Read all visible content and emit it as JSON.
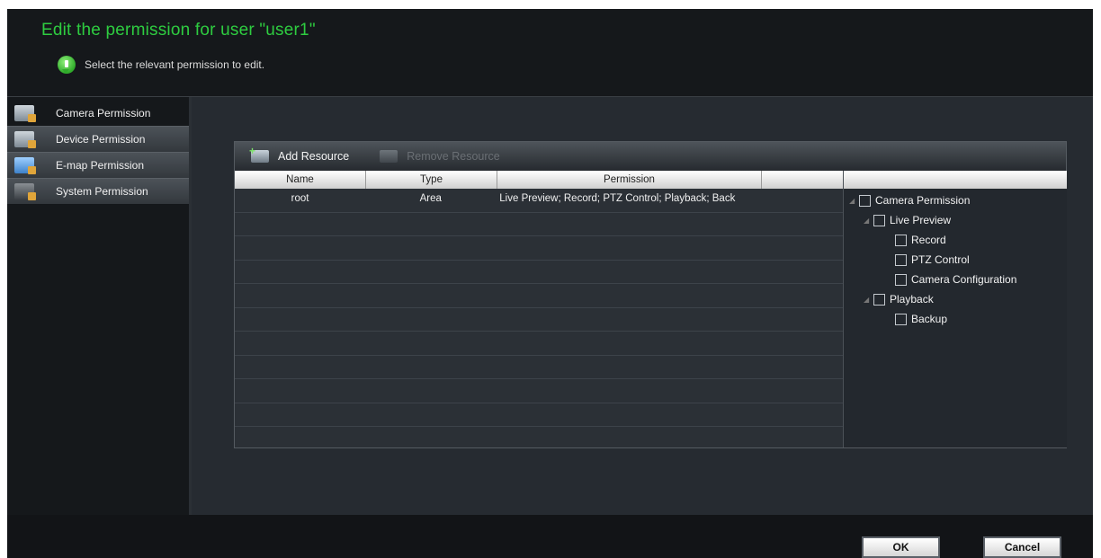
{
  "header": {
    "title": "Edit the permission for user \"user1\"",
    "hint": "Select the relevant permission to edit."
  },
  "sidebar": {
    "items": [
      {
        "label": "Camera Permission",
        "icon": "camera-lock-icon"
      },
      {
        "label": "Device Permission",
        "icon": "device-lock-icon"
      },
      {
        "label": "E-map Permission",
        "icon": "emap-lock-icon"
      },
      {
        "label": "System Permission",
        "icon": "system-lock-icon"
      }
    ]
  },
  "toolbar": {
    "add_label": "Add Resource",
    "remove_label": "Remove Resource"
  },
  "table": {
    "columns": [
      "Name",
      "Type",
      "Permission",
      ""
    ],
    "rows": [
      {
        "name": "root",
        "type": "Area",
        "permission": "Live Preview; Record; PTZ Control; Playback; Back"
      }
    ]
  },
  "tree": {
    "root": "Camera Permission",
    "live_preview": "Live Preview",
    "record": "Record",
    "ptz": "PTZ Control",
    "camera_config": "Camera Configuration",
    "playback": "Playback",
    "backup": "Backup"
  },
  "footer": {
    "ok_label": "OK",
    "cancel_label": "Cancel"
  },
  "colors": {
    "title_green": "#2ecc40",
    "background": "#1e2226"
  }
}
